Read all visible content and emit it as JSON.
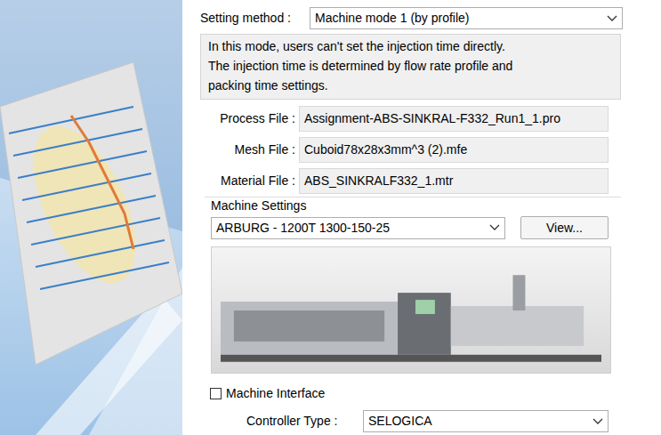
{
  "setting_method": {
    "label": "Setting method :",
    "value": "Machine mode 1 (by profile)"
  },
  "info": [
    "In this mode, users can't set the injection time directly.",
    "The injection time is determined by flow rate profile and",
    "packing time settings."
  ],
  "files": [
    {
      "label": "Process File :",
      "value": "Assignment-ABS-SINKRAL-F332_Run1_1.pro"
    },
    {
      "label": "Mesh File :",
      "value": "Cuboid78x28x3mm^3 (2).mfe"
    },
    {
      "label": "Material File :",
      "value": "ABS_SINKRALF332_1.mtr"
    }
  ],
  "machine_settings": {
    "title": "Machine Settings",
    "machine": "ARBURG - 1200T 1300-150-25",
    "view_button": "View..."
  },
  "machine_interface": {
    "label": "Machine Interface",
    "checked": false
  },
  "controller_type": {
    "label": "Controller Type :",
    "value": "SELOGICA"
  }
}
